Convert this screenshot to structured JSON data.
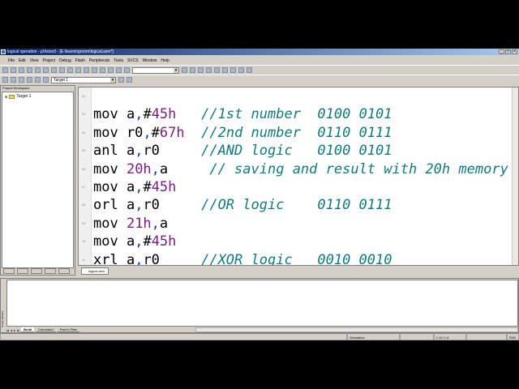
{
  "window": {
    "title": "logical operation - µVision3 - [E:\\learningroom\\logical.asm*]",
    "controls": [
      "_",
      "□",
      "×"
    ]
  },
  "menu": [
    "File",
    "Edit",
    "View",
    "Project",
    "Debug",
    "Flash",
    "Peripherals",
    "Tools",
    "SVCS",
    "Window",
    "Help"
  ],
  "toolbar": {
    "find_value": "",
    "target_select": "Target 1"
  },
  "workspace": {
    "title": "Project Workspace",
    "tree": [
      {
        "label": "Target 1",
        "icon": "folder-icon"
      }
    ],
    "tabs": [
      "files-icon",
      "regs-icon",
      "books-icon",
      "functions-icon",
      "templates-icon"
    ]
  },
  "editor": {
    "tab": "logical.asm",
    "lines": [
      {
        "n": "02",
        "tokens": []
      },
      {
        "n": "03",
        "tokens": [
          [
            "kw",
            "mov a"
          ],
          [
            "punct",
            ","
          ],
          [
            "kw",
            "#"
          ],
          [
            "num",
            "45h"
          ],
          [
            "kw",
            "   "
          ],
          [
            "comment",
            "//1st number  0100 0101"
          ]
        ]
      },
      {
        "n": "04",
        "tokens": [
          [
            "kw",
            "mov r0"
          ],
          [
            "punct",
            ","
          ],
          [
            "kw",
            "#"
          ],
          [
            "num",
            "67h"
          ],
          [
            "kw",
            "  "
          ],
          [
            "comment",
            "//2nd number  0110 0111"
          ]
        ]
      },
      {
        "n": "05",
        "tokens": [
          [
            "kw",
            "anl a"
          ],
          [
            "punct",
            ","
          ],
          [
            "kw",
            "r0     "
          ],
          [
            "comment",
            "//AND logic   0100 0101"
          ]
        ]
      },
      {
        "n": "06",
        "tokens": [
          [
            "kw",
            "mov "
          ],
          [
            "num",
            "20h"
          ],
          [
            "punct",
            ","
          ],
          [
            "kw",
            "a     "
          ],
          [
            "comment",
            "// saving and result with 20h memory"
          ]
        ]
      },
      {
        "n": "07",
        "tokens": [
          [
            "kw",
            "mov a"
          ],
          [
            "punct",
            ","
          ],
          [
            "kw",
            "#"
          ],
          [
            "num",
            "45h"
          ]
        ]
      },
      {
        "n": "08",
        "tokens": [
          [
            "kw",
            "orl a"
          ],
          [
            "punct",
            ","
          ],
          [
            "kw",
            "r0     "
          ],
          [
            "comment",
            "//OR logic    0110 0111"
          ]
        ]
      },
      {
        "n": "09",
        "tokens": [
          [
            "kw",
            "mov "
          ],
          [
            "num",
            "21h"
          ],
          [
            "punct",
            ","
          ],
          [
            "kw",
            "a"
          ]
        ]
      },
      {
        "n": "10",
        "tokens": [
          [
            "kw",
            "mov a"
          ],
          [
            "punct",
            ","
          ],
          [
            "kw",
            "#"
          ],
          [
            "num",
            "45h"
          ]
        ]
      },
      {
        "n": "11",
        "tokens": [
          [
            "kw",
            "xrl a"
          ],
          [
            "punct",
            ","
          ],
          [
            "kw",
            "r0     "
          ],
          [
            "comment",
            "//XOR logic   0010 0010"
          ]
        ]
      }
    ]
  },
  "output": {
    "side_label": "Output Window",
    "tabs": [
      "Build",
      "Command",
      "Find in Files"
    ],
    "active_tab": "Build"
  },
  "status": {
    "mode": "Simulation",
    "position": "L:10 C:4",
    "rw": "R/W"
  }
}
